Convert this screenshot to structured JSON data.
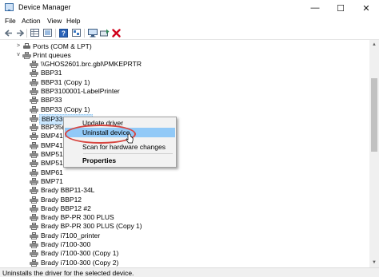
{
  "window": {
    "title": "Device Manager",
    "minimize": "—",
    "maximize": "☐",
    "close": "✕"
  },
  "menu": [
    "File",
    "Action",
    "View",
    "Help"
  ],
  "toolbar": {
    "icons": [
      "back-icon",
      "forward-icon",
      "properties-grid-icon",
      "device-list-icon",
      "help-icon",
      "view-icon",
      "monitor-icon",
      "scan-hardware-icon",
      "uninstall-icon"
    ]
  },
  "tree": {
    "ports_label": "Ports (COM & LPT)",
    "print_queues_label": "Print queues",
    "items": [
      "\\\\GHOS2601.brc.gbl\\PMKEPRTR",
      "BBP31",
      "BBP31 (Copy 1)",
      "BBP3100001-LabelPrinter",
      "BBP33",
      "BBP33 (Copy 1)",
      "BBP33 (Copy 2)",
      "BBP35(2",
      "BMP41",
      "BMP41 (C",
      "BMP51(2",
      "BMP51 (C",
      "BMP61",
      "BMP71",
      "Brady BBP11-34L",
      "Brady BBP12",
      "Brady BBP12 #2",
      "Brady BP-PR 300 PLUS",
      "Brady BP-PR 300 PLUS (Copy 1)",
      "Brady i7100_printer",
      "Brady i7100-300",
      "Brady i7100-300 (Copy 1)",
      "Brady i7100-300 (Copy 2)"
    ],
    "selected_index": 6
  },
  "context_menu": {
    "update_driver": "Update driver",
    "uninstall_device": "Uninstall device",
    "scan_hardware": "Scan for hardware changes",
    "properties": "Properties",
    "highlighted": "Uninstall device"
  },
  "status": "Uninstalls the driver for the selected device.",
  "colors": {
    "highlight_blue": "#91c9f7",
    "selected_row": "#cce8ff",
    "annotation_red": "#d8453f",
    "uninstall_red": "#d0021b",
    "scan_green": "#2e8b57"
  }
}
